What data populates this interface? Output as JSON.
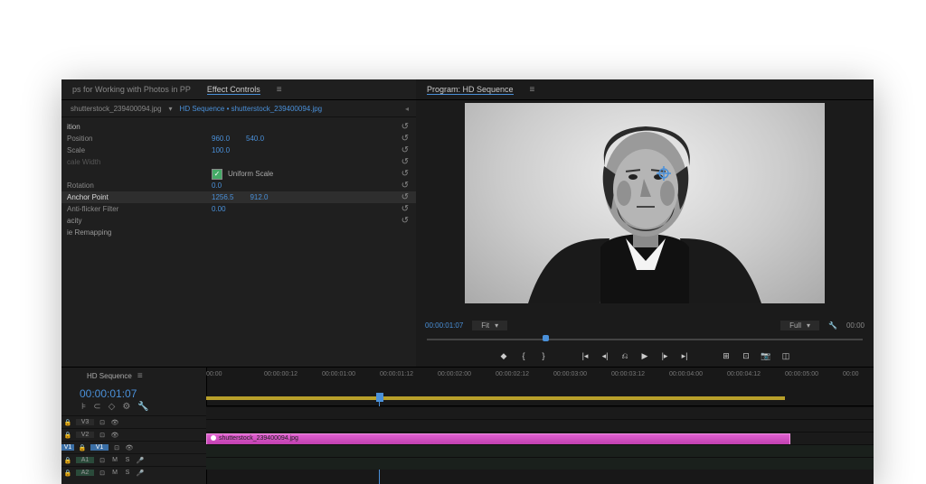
{
  "fx": {
    "tab1": "ps for Working with Photos in PP",
    "tab2": "Effect Controls",
    "master": "shutterstock_239400094.jpg",
    "seq": "HD Sequence • shutterstock_239400094.jpg",
    "rows": {
      "motion": "ition",
      "position": "Position",
      "pos_x": "960.0",
      "pos_y": "540.0",
      "scale": "Scale",
      "scale_v": "100.0",
      "scalew": "cale Width",
      "uniform": "Uniform Scale",
      "rotation": "Rotation",
      "rot_v": "0.0",
      "anchor": "Anchor Point",
      "anc_x": "1256.5",
      "anc_y": "912.0",
      "flicker": "Anti-flicker Filter",
      "flk_v": "0.00",
      "opacity": "acity",
      "remap": "ie Remapping"
    }
  },
  "program": {
    "tab": "Program: HD Sequence",
    "tc": "00:00:01:07",
    "fit": "Fit",
    "full": "Full",
    "tc2": "00:00"
  },
  "timeline": {
    "title": "HD Sequence",
    "tc": "00:00:01:07",
    "ticks": [
      "00:00",
      "00:00:00:12",
      "00:00:01:00",
      "00:00:01:12",
      "00:00:02:00",
      "00:00:02:12",
      "00:00:03:00",
      "00:00:03:12",
      "00:00:04:00",
      "00:00:04:12",
      "00:00:05:00",
      "00:00"
    ],
    "tracks": {
      "v3": "V3",
      "v2": "V2",
      "v1": "V1",
      "a1": "A1",
      "a2": "A2"
    },
    "clip": "shutterstock_239400094.jpg",
    "mute": "M",
    "solo": "S"
  }
}
